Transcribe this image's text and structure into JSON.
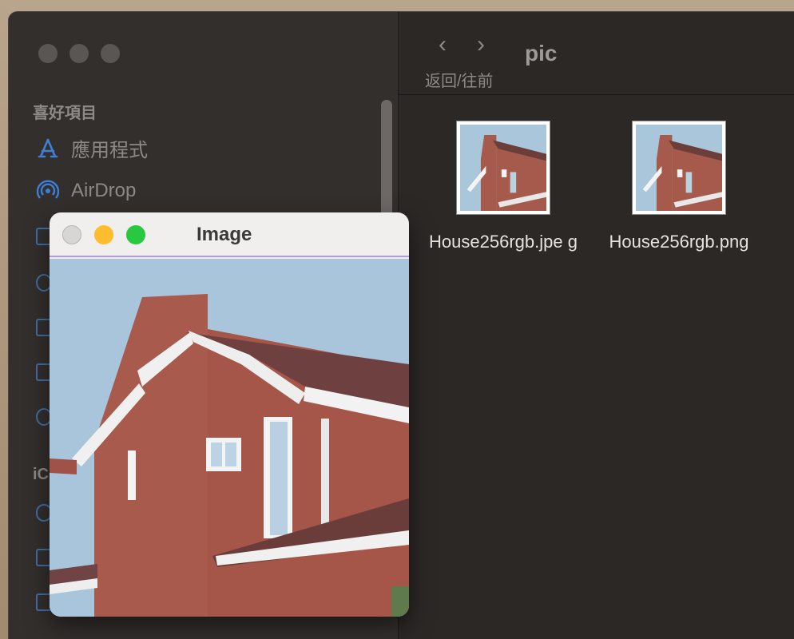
{
  "sidebar": {
    "section_favorites": "喜好項目",
    "items": [
      {
        "label": "應用程式",
        "icon": "applications-icon"
      },
      {
        "label": "AirDrop",
        "icon": "airdrop-icon"
      }
    ],
    "section_icloud": "iC"
  },
  "toolbar": {
    "back_glyph": "‹",
    "forward_glyph": "›",
    "nav_caption": "返回/往前",
    "title": "pic"
  },
  "files": [
    {
      "name": "House256rgb.jpeg",
      "display": "House256rgb.jpe g"
    },
    {
      "name": "House256rgb.png",
      "display": "House256rgb.png"
    }
  ],
  "image_window": {
    "title": "Image"
  },
  "colors": {
    "close": "#d7d6d5",
    "minimize": "#febc2e",
    "zoom": "#28c840",
    "accent": "#3f7fd6"
  }
}
